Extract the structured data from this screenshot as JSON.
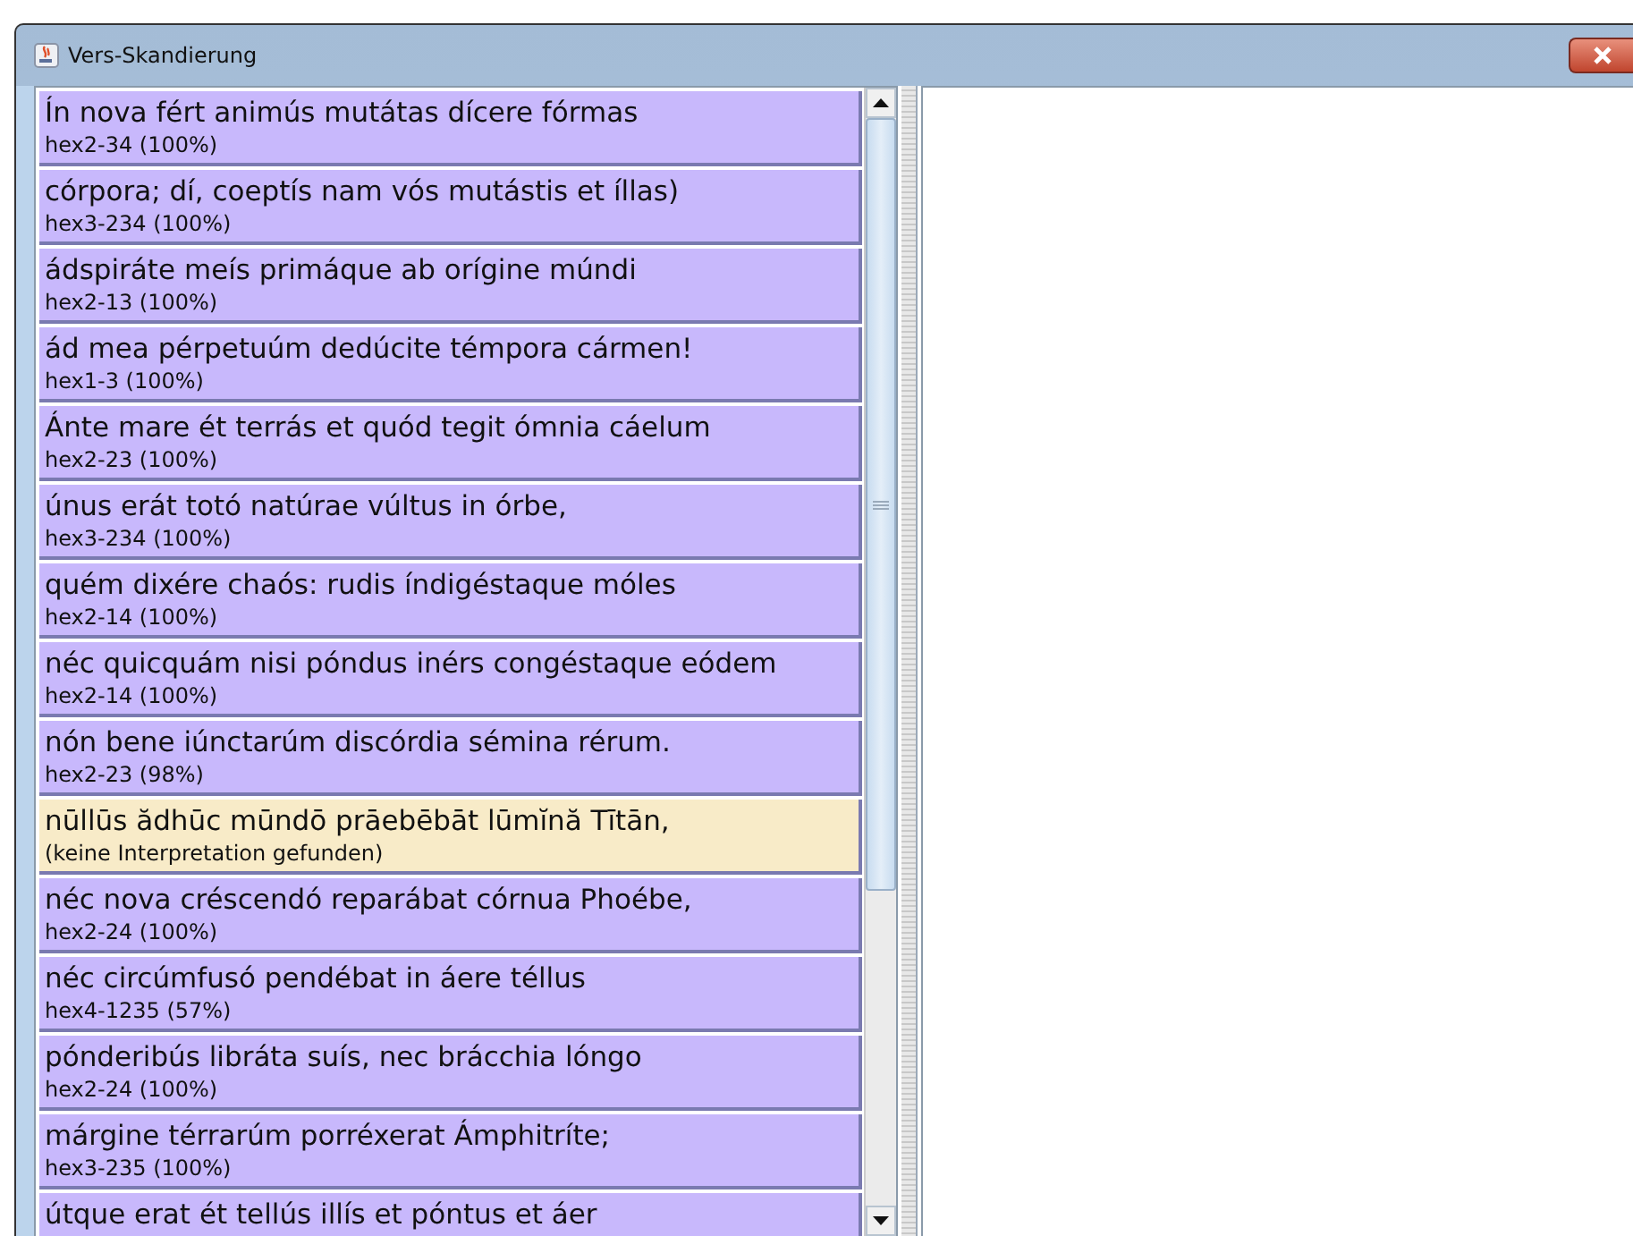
{
  "window": {
    "title": "Vers-Skandierung"
  },
  "verses": [
    {
      "text": "Ín nova fért animús mutátas dícere fórmas",
      "result": "hex2-34 (100%)",
      "kind": "found"
    },
    {
      "text": "córpora; dí, coeptís  nam vós mutástis et íllas)",
      "result": "hex3-234 (100%)",
      "kind": "found"
    },
    {
      "text": "ádspiráte meís primáque ab orígine múndi",
      "result": "hex2-13 (100%)",
      "kind": "found"
    },
    {
      "text": "ád mea pérpetuúm dedúcite témpora cármen!",
      "result": "hex1-3 (100%)",
      "kind": "found"
    },
    {
      "text": "Ánte mare ét terrás et quód tegit ómnia cáelum",
      "result": "hex2-23 (100%)",
      "kind": "found"
    },
    {
      "text": "únus erát totó natúrae vúltus in órbe,",
      "result": "hex3-234 (100%)",
      "kind": "found"
    },
    {
      "text": "quém dixére chaós: rudis índigéstaque móles",
      "result": "hex2-14 (100%)",
      "kind": "found"
    },
    {
      "text": "néc quicquám nisi póndus inérs congéstaque eódem",
      "result": "hex2-14 (100%)",
      "kind": "found"
    },
    {
      "text": "nón bene iúnctarúm discórdia sémina rérum.",
      "result": "hex2-23 (98%)",
      "kind": "found"
    },
    {
      "text": "nūllūs ădhūc mūndō prāebēbāt lūmĭnă Tītān,",
      "result": "(keine Interpretation gefunden)",
      "kind": "missing"
    },
    {
      "text": "néc nova créscendó reparábat córnua Phoébe,",
      "result": "hex2-24 (100%)",
      "kind": "found"
    },
    {
      "text": "néc circúmfusó pendébat in áere téllus",
      "result": "hex4-1235 (57%)",
      "kind": "found"
    },
    {
      "text": "pónderibús libráta suís, nec brácchia lóngo",
      "result": "hex2-24 (100%)",
      "kind": "found"
    },
    {
      "text": "márgine térrarúm porréxerat Ámphitríte;",
      "result": "hex3-235 (100%)",
      "kind": "found"
    },
    {
      "text": "útque erat ét tellús illís et póntus et áer",
      "kind": "found"
    }
  ]
}
